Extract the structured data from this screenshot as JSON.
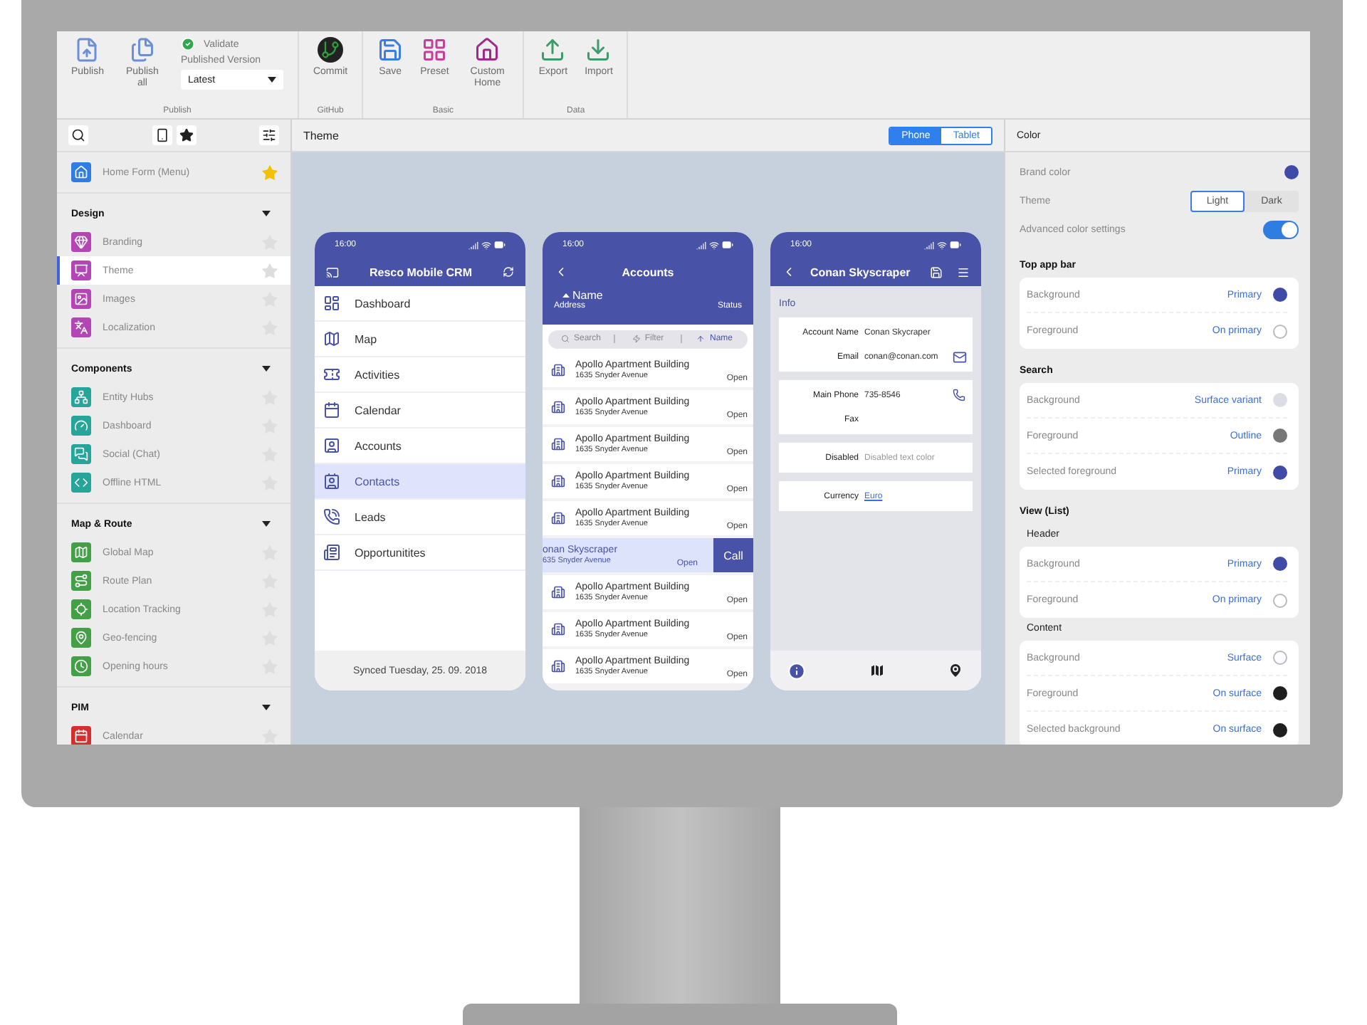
{
  "ribbon": {
    "groups": [
      {
        "label": "Publish",
        "buttons": [
          {
            "label": "Publish"
          },
          {
            "label": "Publish all"
          }
        ],
        "validate": "Validate",
        "version_label": "Published Version",
        "version": "Latest"
      },
      {
        "label": "GitHub",
        "buttons": [
          {
            "label": "Commit"
          }
        ]
      },
      {
        "label": "Basic",
        "buttons": [
          {
            "label": "Save"
          },
          {
            "label": "Preset"
          },
          {
            "label": "Custom Home"
          }
        ]
      },
      {
        "label": "Data",
        "buttons": [
          {
            "label": "Export"
          },
          {
            "label": "Import"
          }
        ]
      }
    ]
  },
  "sidebar": {
    "home": {
      "label": "Home Form (Menu)",
      "starred": true
    },
    "sections": [
      {
        "title": "Design",
        "expanded": true,
        "items": [
          {
            "label": "Branding",
            "selected": false,
            "starred": false,
            "color": "#b445b4"
          },
          {
            "label": "Theme",
            "selected": true,
            "starred": false,
            "color": "#b445b4"
          },
          {
            "label": "Images",
            "selected": false,
            "starred": false,
            "color": "#b445b4"
          },
          {
            "label": "Localization",
            "selected": false,
            "starred": false,
            "color": "#b445b4"
          }
        ]
      },
      {
        "title": "Components",
        "expanded": true,
        "items": [
          {
            "label": "Entity Hubs",
            "selected": false,
            "starred": false,
            "color": "#26a69a"
          },
          {
            "label": "Dashboard",
            "selected": false,
            "starred": false,
            "color": "#26a69a"
          },
          {
            "label": "Social (Chat)",
            "selected": false,
            "starred": false,
            "color": "#26a69a"
          },
          {
            "label": "Offline HTML",
            "selected": false,
            "starred": false,
            "color": "#26a69a"
          }
        ]
      },
      {
        "title": "Map & Route",
        "expanded": true,
        "items": [
          {
            "label": "Global Map",
            "selected": false,
            "starred": false,
            "color": "#43a047"
          },
          {
            "label": "Route Plan",
            "selected": false,
            "starred": false,
            "color": "#43a047"
          },
          {
            "label": "Location Tracking",
            "selected": false,
            "starred": false,
            "color": "#43a047"
          },
          {
            "label": "Geo-fencing",
            "selected": false,
            "starred": false,
            "color": "#43a047"
          },
          {
            "label": "Opening hours",
            "selected": false,
            "starred": false,
            "color": "#43a047"
          }
        ]
      },
      {
        "title": "PIM",
        "expanded": true,
        "items": [
          {
            "label": "Calendar",
            "selected": false,
            "starred": false,
            "color": "#d32f2f"
          }
        ]
      }
    ]
  },
  "editor": {
    "title": "Theme",
    "view_toggle": [
      {
        "label": "Phone",
        "selected": true
      },
      {
        "label": "Tablet",
        "selected": false
      }
    ],
    "phones": [
      {
        "kind": "menu",
        "time": "16:00",
        "title": "Resco Mobile CRM",
        "items": [
          {
            "label": "Dashboard",
            "selected": false
          },
          {
            "label": "Map",
            "selected": false
          },
          {
            "label": "Activities",
            "selected": false
          },
          {
            "label": "Calendar",
            "selected": false
          },
          {
            "label": "Accounts",
            "selected": false
          },
          {
            "label": "Contacts",
            "selected": true
          },
          {
            "label": "Leads",
            "selected": false
          },
          {
            "label": "Opportunitites",
            "selected": false
          }
        ],
        "footer": "Synced Tuesday, 25. 09. 2018"
      },
      {
        "kind": "list",
        "time": "16:00",
        "title": "Accounts",
        "header": {
          "sort": "Name",
          "address": "Address",
          "status": "Status"
        },
        "search": {
          "placeholder": "Search",
          "filter": "Filter",
          "sort": "Name"
        },
        "rows": [
          {
            "name": "Apollo Apartment Building",
            "address": "1635 Snyder Avenue",
            "status": "Open",
            "swiped": false
          },
          {
            "name": "Apollo Apartment Building",
            "address": "1635 Snyder Avenue",
            "status": "Open",
            "swiped": false
          },
          {
            "name": "Apollo Apartment Building",
            "address": "1635 Snyder Avenue",
            "status": "Open",
            "swiped": false
          },
          {
            "name": "Apollo Apartment Building",
            "address": "1635 Snyder Avenue",
            "status": "Open",
            "swiped": false
          },
          {
            "name": "Apollo Apartment Building",
            "address": "1635 Snyder Avenue",
            "status": "Open",
            "swiped": false
          },
          {
            "name": "onan Skyscraper",
            "address": "635 Snyder Avenue",
            "status": "Open",
            "swiped": true,
            "action": "Call"
          },
          {
            "name": "Apollo Apartment Building",
            "address": "1635 Snyder Avenue",
            "status": "Open",
            "swiped": false
          },
          {
            "name": "Apollo Apartment Building",
            "address": "1635 Snyder Avenue",
            "status": "Open",
            "swiped": false
          },
          {
            "name": "Apollo Apartment Building",
            "address": "1635 Snyder Avenue",
            "status": "Open",
            "swiped": false
          }
        ]
      },
      {
        "kind": "form",
        "time": "16:00",
        "title": "Conan Skyscraper",
        "section": "Info",
        "groups": [
          {
            "fields": [
              {
                "label": "Account Name",
                "value": "Conan Skycraper",
                "kind": "text"
              },
              {
                "label": "Email",
                "value": "conan@conan.com",
                "kind": "email"
              }
            ]
          },
          {
            "fields": [
              {
                "label": "Main Phone",
                "value": "735-8546",
                "kind": "phone"
              },
              {
                "label": "Fax",
                "kind": "text"
              }
            ]
          },
          {
            "fields": [
              {
                "label": "Disabled",
                "value": "Disabled text color",
                "kind": "disabled"
              }
            ]
          },
          {
            "fields": [
              {
                "label": "Currency",
                "value": "Euro",
                "kind": "link"
              }
            ]
          }
        ],
        "tabs": [
          {
            "selected": true
          },
          {
            "selected": false
          },
          {
            "selected": false
          }
        ]
      }
    ]
  },
  "color_panel": {
    "title": "Color",
    "brand": {
      "label": "Brand color",
      "color": "#3f4ba6"
    },
    "theme": {
      "label": "Theme",
      "options": [
        {
          "label": "Light",
          "selected": true
        },
        {
          "label": "Dark",
          "selected": false
        }
      ]
    },
    "advanced": {
      "label": "Advanced color settings",
      "on": true
    },
    "sections": [
      {
        "title": "Top app bar",
        "groups": [
          {
            "rows": [
              {
                "label": "Background",
                "value": "Primary",
                "color": "#3f4ba6"
              },
              {
                "label": "Foreground",
                "value": "On primary",
                "color": "#ffffff"
              }
            ]
          }
        ]
      },
      {
        "title": "Search",
        "groups": [
          {
            "rows": [
              {
                "label": "Background",
                "value": "Surface variant",
                "color": "#dcdce4"
              },
              {
                "label": "Foreground",
                "value": "Outline",
                "color": "#777777"
              },
              {
                "label": "Selected foreground",
                "value": "Primary",
                "color": "#3f4ba6"
              }
            ]
          }
        ]
      },
      {
        "title": "View (List)",
        "groups": [
          {
            "subtitle": "Header",
            "rows": [
              {
                "label": "Background",
                "value": "Primary",
                "color": "#3f4ba6"
              },
              {
                "label": "Foreground",
                "value": "On primary",
                "color": "#ffffff"
              }
            ]
          },
          {
            "subtitle": "Content",
            "rows": [
              {
                "label": "Background",
                "value": "Surface",
                "color": "#fdfbff"
              },
              {
                "label": "Foreground",
                "value": "On surface",
                "color": "#1f1f1f"
              },
              {
                "label": "Selected background",
                "value": "On surface",
                "color": "#1f1f1f"
              }
            ]
          }
        ]
      }
    ]
  }
}
